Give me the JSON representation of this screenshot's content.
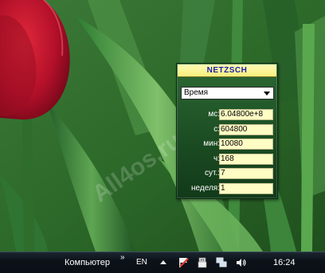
{
  "gadget": {
    "title": "NETZSCH",
    "unit_select": "Время",
    "rows": [
      {
        "label": "мс",
        "value": "6.04800e+8"
      },
      {
        "label": "с",
        "value": "604800"
      },
      {
        "label": "мин",
        "value": "10080"
      },
      {
        "label": "ч",
        "value": "168"
      },
      {
        "label": "сут.",
        "value": "7"
      },
      {
        "label": "неделя",
        "value": "1"
      }
    ]
  },
  "taskbar": {
    "toolbar_label": "Компьютер",
    "chevrons": "»",
    "language": "EN",
    "clock": "16:24",
    "tray_icons": [
      "show-hidden-icons-icon",
      "action-center-flag-icon",
      "usb-device-icon",
      "network-icon",
      "volume-icon"
    ]
  },
  "watermark": "All4os.ru",
  "colors": {
    "gadget_title_bg": "#f7ee7a",
    "gadget_title_text": "#1b1fa8",
    "gadget_body": "#1b4b22",
    "field_bg": "#fffcc4",
    "taskbar": "#0c1219"
  }
}
